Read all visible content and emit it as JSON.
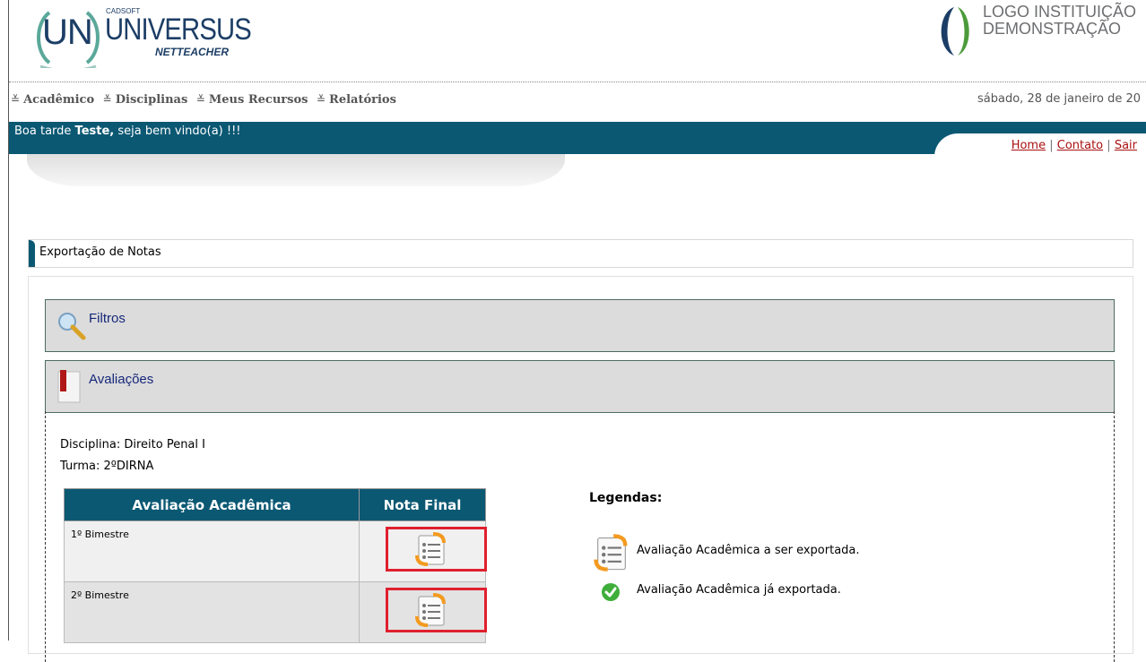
{
  "logo": {
    "main": "UN",
    "cadsoft": "CADSOFT",
    "name": "UNIVERSUS",
    "sub": "NETTEACHER"
  },
  "institution_logo": {
    "line1": "LOGO INSTITUIÇÃO",
    "line2": "DEMONSTRAÇÃO"
  },
  "menu": [
    "Acadêmico",
    "Disciplinas",
    "Meus Recursos",
    "Relatórios"
  ],
  "date": "sábado, 28 de janeiro de 20",
  "greeting": {
    "prefix": "Boa tarde ",
    "name": "Teste,",
    "suffix": " seja bem vindo(a) !!!"
  },
  "top_links": {
    "home": "Home",
    "contato": "Contato",
    "sair": "Sair",
    "sep": "|"
  },
  "page_title": "Exportação de Notas",
  "panels": {
    "filtros": "Filtros",
    "avaliacoes": "Avaliações"
  },
  "info": {
    "disciplina": "Disciplina: Direito Penal I",
    "turma": "Turma: 2ºDIRNA"
  },
  "table": {
    "headers": [
      "Avaliação Acadêmica",
      "Nota Final"
    ],
    "rows": [
      {
        "label": "1º Bimestre"
      },
      {
        "label": "2º Bimestre"
      }
    ]
  },
  "legend": {
    "title": "Legendas:",
    "export": "Avaliação Acadêmica a ser exportada.",
    "exported": "Avaliação Acadêmica já exportada."
  },
  "colors": {
    "accent": "#0b5873",
    "panel_text": "#16287a",
    "highlight": "#e0202e",
    "link": "#aa1111"
  }
}
